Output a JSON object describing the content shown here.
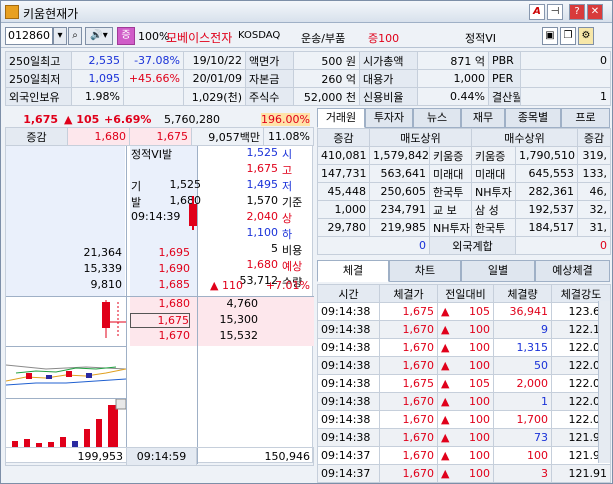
{
  "window": {
    "title": "키움현재가"
  },
  "toolbar": {
    "code": "012860",
    "jeung": "증",
    "pct": "100%",
    "stock_name": "모베이스전자",
    "market": "KOSDAQ",
    "sector": "운송/부품",
    "margin": "증100",
    "vi": "정적VI"
  },
  "info": {
    "rows": [
      [
        "250일최고",
        "2,535",
        "-37.08%",
        "19/10/22",
        "액면가",
        "500 원",
        "시가총액",
        "871 억",
        "PBR",
        "0"
      ],
      [
        "250일최저",
        "1,095",
        "+45.66%",
        "20/01/09",
        "자본금",
        "260 억",
        "대용가",
        "1,000",
        "PER",
        ""
      ],
      [
        "외국인보유",
        "1.98%",
        "",
        "1,029(천)",
        "주식수",
        "52,000 천",
        "신용비율",
        "0.44%",
        "결산월",
        "1"
      ]
    ]
  },
  "price": {
    "current": "1,675",
    "change": "105",
    "change_pct": "+6.69%",
    "volume": "5,760,280",
    "vol_ratio": "196.00%",
    "jeunggam": "증감",
    "jg_val1": "1,680",
    "jg_val2": "1,675",
    "amount": "9,057백만",
    "turnover": "11.08%"
  },
  "orderbook": {
    "asks": [
      {
        "qty": "",
        "price": ""
      },
      {
        "qty": "",
        "price": ""
      },
      {
        "qty": "",
        "price": ""
      },
      {
        "qty": "",
        "price": ""
      },
      {
        "qty": "",
        "price": ""
      },
      {
        "qty": "",
        "price": ""
      },
      {
        "qty": "21,364",
        "price": "1,695"
      },
      {
        "qty": "15,339",
        "price": "1,690"
      },
      {
        "qty": "9,810",
        "price": "1,685"
      }
    ],
    "bids": [
      {
        "price": "1,680",
        "qty": "4,760"
      },
      {
        "price": "1,675",
        "qty": "15,300"
      },
      {
        "price": "1,670",
        "qty": "15,532"
      }
    ],
    "total_ask": "199,953",
    "time": "09:14:59",
    "total_bid": "150,946"
  },
  "vi_panel": {
    "title": "정적VI발",
    "gi_label": "기",
    "gi_val": "1,525",
    "bal_label": "발",
    "bal_val": "1,680",
    "time": "09:14:39"
  },
  "stats": [
    {
      "val": "1,525",
      "lbl": "시",
      "cls": "blue"
    },
    {
      "val": "1,675",
      "lbl": "고",
      "cls": "red"
    },
    {
      "val": "1,495",
      "lbl": "저",
      "cls": "blue"
    },
    {
      "val": "1,570",
      "lbl": "기준",
      "cls": ""
    },
    {
      "val": "2,040",
      "lbl": "상",
      "cls": "red"
    },
    {
      "val": "1,100",
      "lbl": "하",
      "cls": "blue"
    },
    {
      "val": "5",
      "lbl": "비용",
      "cls": ""
    },
    {
      "val": "1,680",
      "lbl": "예상",
      "cls": "red"
    },
    {
      "val": "53,712",
      "lbl": "수량",
      "cls": ""
    }
  ],
  "expected": {
    "change": "▲ 110",
    "pct": "+7.01%"
  },
  "broker": {
    "tabs": [
      "거래원",
      "투자자",
      "뉴스",
      "재무",
      "종목별",
      "프로"
    ],
    "header": [
      "증감",
      "매도상위",
      "매수상위",
      "증감"
    ],
    "rows": [
      [
        "410,081",
        "1,579,842",
        "키움증",
        "키움증",
        "1,790,510",
        "319,"
      ],
      [
        "147,731",
        "563,641",
        "미래대",
        "미래대",
        "645,553",
        "133,"
      ],
      [
        "45,448",
        "250,605",
        "한국투",
        "NH투자",
        "282,361",
        "46,"
      ],
      [
        "1,000",
        "234,791",
        "교 보",
        "삼 성",
        "192,537",
        "32,"
      ],
      [
        "29,780",
        "219,985",
        "NH투자",
        "한국투",
        "184,517",
        "31,"
      ]
    ],
    "foreign": [
      "0",
      "외국계합",
      "0"
    ]
  },
  "trades": {
    "tabs": [
      "체결",
      "차트",
      "일별",
      "예상체결"
    ],
    "header": [
      "시간",
      "체결가",
      "전일대비",
      "체결량",
      "체결강도"
    ],
    "rows": [
      [
        "09:14:38",
        "1,675",
        "105",
        "36,941",
        "123.64"
      ],
      [
        "09:14:38",
        "1,670",
        "100",
        "9",
        "122.10"
      ],
      [
        "09:14:38",
        "1,670",
        "100",
        "1,315",
        "122.09"
      ],
      [
        "09:14:38",
        "1,670",
        "100",
        "50",
        "122.08"
      ],
      [
        "09:14:38",
        "1,675",
        "105",
        "2,000",
        "122.08"
      ],
      [
        "09:14:38",
        "1,670",
        "100",
        "1",
        "122.00"
      ],
      [
        "09:14:38",
        "1,670",
        "100",
        "1,700",
        "122.00"
      ],
      [
        "09:14:38",
        "1,670",
        "100",
        "73",
        "121.92"
      ],
      [
        "09:14:37",
        "1,670",
        "100",
        "100",
        "121.92"
      ],
      [
        "09:14:37",
        "1,670",
        "100",
        "3",
        "121.91"
      ]
    ],
    "qty_colors": [
      "red",
      "blue",
      "blue",
      "blue",
      "red",
      "blue",
      "red",
      "blue",
      "red",
      "red"
    ]
  }
}
